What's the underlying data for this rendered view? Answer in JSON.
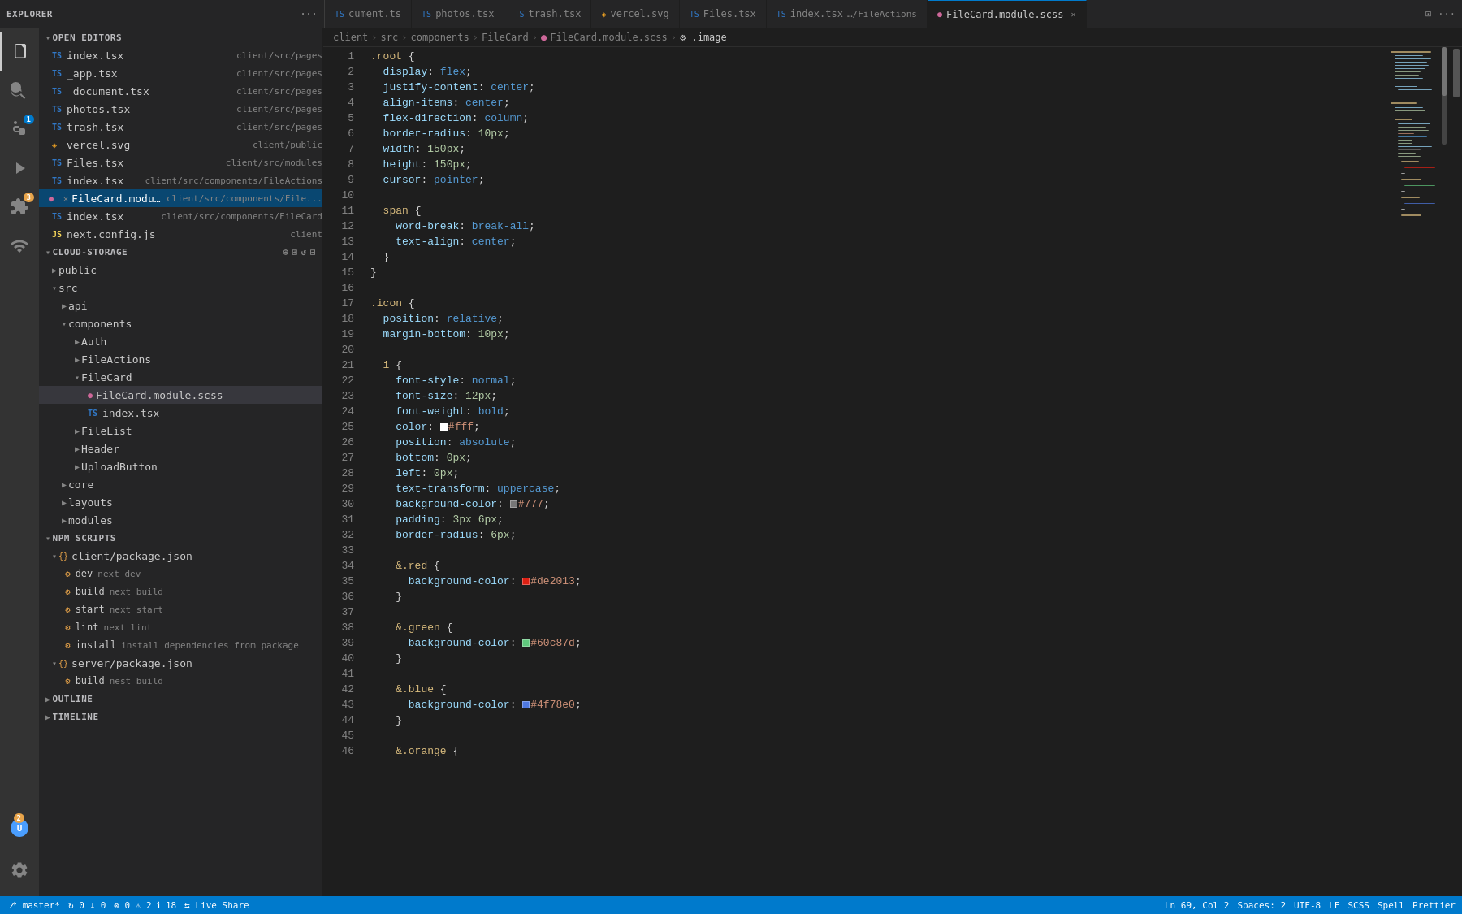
{
  "tabs": [
    {
      "id": "cument",
      "label": "cument.ts",
      "type": "ts",
      "active": false
    },
    {
      "id": "photos",
      "label": "photos.tsx",
      "type": "ts",
      "active": false
    },
    {
      "id": "trash",
      "label": "trash.tsx",
      "type": "ts",
      "active": false
    },
    {
      "id": "vercel",
      "label": "vercel.svg",
      "type": "svg",
      "active": false
    },
    {
      "id": "files",
      "label": "Files.tsx",
      "type": "ts",
      "active": false
    },
    {
      "id": "index",
      "label": "index.tsx",
      "type": "ts",
      "sublabel": "…/FileActions",
      "active": false
    },
    {
      "id": "filecard-scss",
      "label": "FileCard.module.scss",
      "type": "scss",
      "active": true,
      "closable": true
    }
  ],
  "breadcrumb": {
    "parts": [
      "client",
      "src",
      "components",
      "FileCard",
      "FileCard.module.scss",
      ".image"
    ]
  },
  "sidebar": {
    "explorer_label": "EXPLORER",
    "open_editors_label": "OPEN EDITORS",
    "cloud_storage_label": "CLOUD-STORAGE",
    "npm_scripts_label": "NPM SCRIPTS",
    "outline_label": "OUTLINE",
    "timeline_label": "TIMELINE"
  },
  "open_editors": [
    {
      "name": "index.tsx",
      "path": "client/src/pages",
      "type": "ts",
      "modified": false
    },
    {
      "name": "_app.tsx",
      "path": "client/src/pages",
      "type": "ts",
      "modified": false
    },
    {
      "name": "_document.tsx",
      "path": "client/src/pages",
      "type": "ts",
      "modified": false
    },
    {
      "name": "photos.tsx",
      "path": "client/src/pages",
      "type": "ts",
      "modified": false
    },
    {
      "name": "trash.tsx",
      "path": "client/src/pages",
      "type": "ts",
      "modified": false
    },
    {
      "name": "vercel.svg",
      "path": "client/public",
      "type": "svg",
      "modified": false
    },
    {
      "name": "Files.tsx",
      "path": "client/src/modules",
      "type": "ts",
      "modified": false
    },
    {
      "name": "index.tsx",
      "path": "client/src/components/FileActions",
      "type": "ts",
      "modified": false
    },
    {
      "name": "FileCard.module.scss",
      "path": "client/src/components/File...",
      "type": "scss",
      "modified": true,
      "active": true
    },
    {
      "name": "index.tsx",
      "path": "client/src/components/FileCard",
      "type": "ts",
      "modified": false
    },
    {
      "name": "next.config.js",
      "path": "client",
      "type": "js",
      "modified": false
    }
  ],
  "tree": {
    "public": {
      "expanded": false
    },
    "src": {
      "expanded": true,
      "children": {
        "api": {
          "expanded": false
        },
        "components": {
          "expanded": true,
          "children": {
            "Auth": {
              "expanded": false
            },
            "FileActions": {
              "expanded": false
            },
            "FileCard": {
              "expanded": true,
              "children": {
                "FileCard.module.scss": {
                  "type": "scss",
                  "active": true
                },
                "index.tsx": {
                  "type": "ts"
                }
              }
            },
            "FileList": {
              "expanded": false
            },
            "Header": {
              "expanded": false
            },
            "UploadButton": {
              "expanded": false
            }
          }
        },
        "core": {
          "expanded": false
        },
        "layouts": {
          "expanded": false
        },
        "modules": {
          "expanded": false
        }
      }
    }
  },
  "npm_scripts": {
    "client_package": "client/package.json",
    "scripts": [
      {
        "name": "dev",
        "cmd": "next dev"
      },
      {
        "name": "build",
        "cmd": "next build"
      },
      {
        "name": "start",
        "cmd": "next start"
      },
      {
        "name": "lint",
        "cmd": "next lint"
      },
      {
        "name": "install",
        "cmd": "install dependencies from package"
      }
    ],
    "server_package": "server/package.json",
    "server_scripts": [
      {
        "name": "build",
        "cmd": "nest build"
      }
    ]
  },
  "code_lines": [
    {
      "n": 1,
      "text": ".root {"
    },
    {
      "n": 2,
      "text": "  display: flex;"
    },
    {
      "n": 3,
      "text": "  justify-content: center;"
    },
    {
      "n": 4,
      "text": "  align-items: center;"
    },
    {
      "n": 5,
      "text": "  flex-direction: column;"
    },
    {
      "n": 6,
      "text": "  border-radius: 10px;"
    },
    {
      "n": 7,
      "text": "  width: 150px;"
    },
    {
      "n": 8,
      "text": "  height: 150px;"
    },
    {
      "n": 9,
      "text": "  cursor: pointer;"
    },
    {
      "n": 10,
      "text": ""
    },
    {
      "n": 11,
      "text": "  span {"
    },
    {
      "n": 12,
      "text": "    word-break: break-all;"
    },
    {
      "n": 13,
      "text": "    text-align: center;"
    },
    {
      "n": 14,
      "text": "  }"
    },
    {
      "n": 15,
      "text": "}"
    },
    {
      "n": 16,
      "text": ""
    },
    {
      "n": 17,
      "text": ".icon {"
    },
    {
      "n": 18,
      "text": "  position: relative;"
    },
    {
      "n": 19,
      "text": "  margin-bottom: 10px;"
    },
    {
      "n": 20,
      "text": ""
    },
    {
      "n": 21,
      "text": "  i {"
    },
    {
      "n": 22,
      "text": "    font-style: normal;"
    },
    {
      "n": 23,
      "text": "    font-size: 12px;"
    },
    {
      "n": 24,
      "text": "    font-weight: bold;"
    },
    {
      "n": 25,
      "text": "    color: #fff;"
    },
    {
      "n": 26,
      "text": "    position: absolute;"
    },
    {
      "n": 27,
      "text": "    bottom: 0px;"
    },
    {
      "n": 28,
      "text": "    left: 0px;"
    },
    {
      "n": 29,
      "text": "    text-transform: uppercase;"
    },
    {
      "n": 30,
      "text": "    background-color: #777;"
    },
    {
      "n": 31,
      "text": "    padding: 3px 6px;"
    },
    {
      "n": 32,
      "text": "    border-radius: 6px;"
    },
    {
      "n": 33,
      "text": ""
    },
    {
      "n": 34,
      "text": "    &.red {"
    },
    {
      "n": 35,
      "text": "      background-color: #de2013;"
    },
    {
      "n": 36,
      "text": "    }"
    },
    {
      "n": 37,
      "text": ""
    },
    {
      "n": 38,
      "text": "    &.green {"
    },
    {
      "n": 39,
      "text": "      background-color: #60c87d;"
    },
    {
      "n": 40,
      "text": "    }"
    },
    {
      "n": 41,
      "text": ""
    },
    {
      "n": 42,
      "text": "    &.blue {"
    },
    {
      "n": 43,
      "text": "      background-color: #4f78e0;"
    },
    {
      "n": 44,
      "text": "    }"
    },
    {
      "n": 45,
      "text": ""
    },
    {
      "n": 46,
      "text": "    &.orange {"
    }
  ],
  "status_bar": {
    "branch": "master*",
    "sync": "↻",
    "errors": "0",
    "warnings": "2",
    "info": "18",
    "position": "Ln 69, Col 2",
    "spaces": "Spaces: 2",
    "encoding": "UTF-8",
    "line_ending": "LF",
    "language": "SCSS",
    "spell": "Spell",
    "prettier": "Prettier"
  },
  "colors": {
    "fff": "#ffffff",
    "777": "#777777",
    "de2013": "#de2013",
    "60c87d": "#60c87d",
    "4f78e0": "#4f78e0"
  }
}
